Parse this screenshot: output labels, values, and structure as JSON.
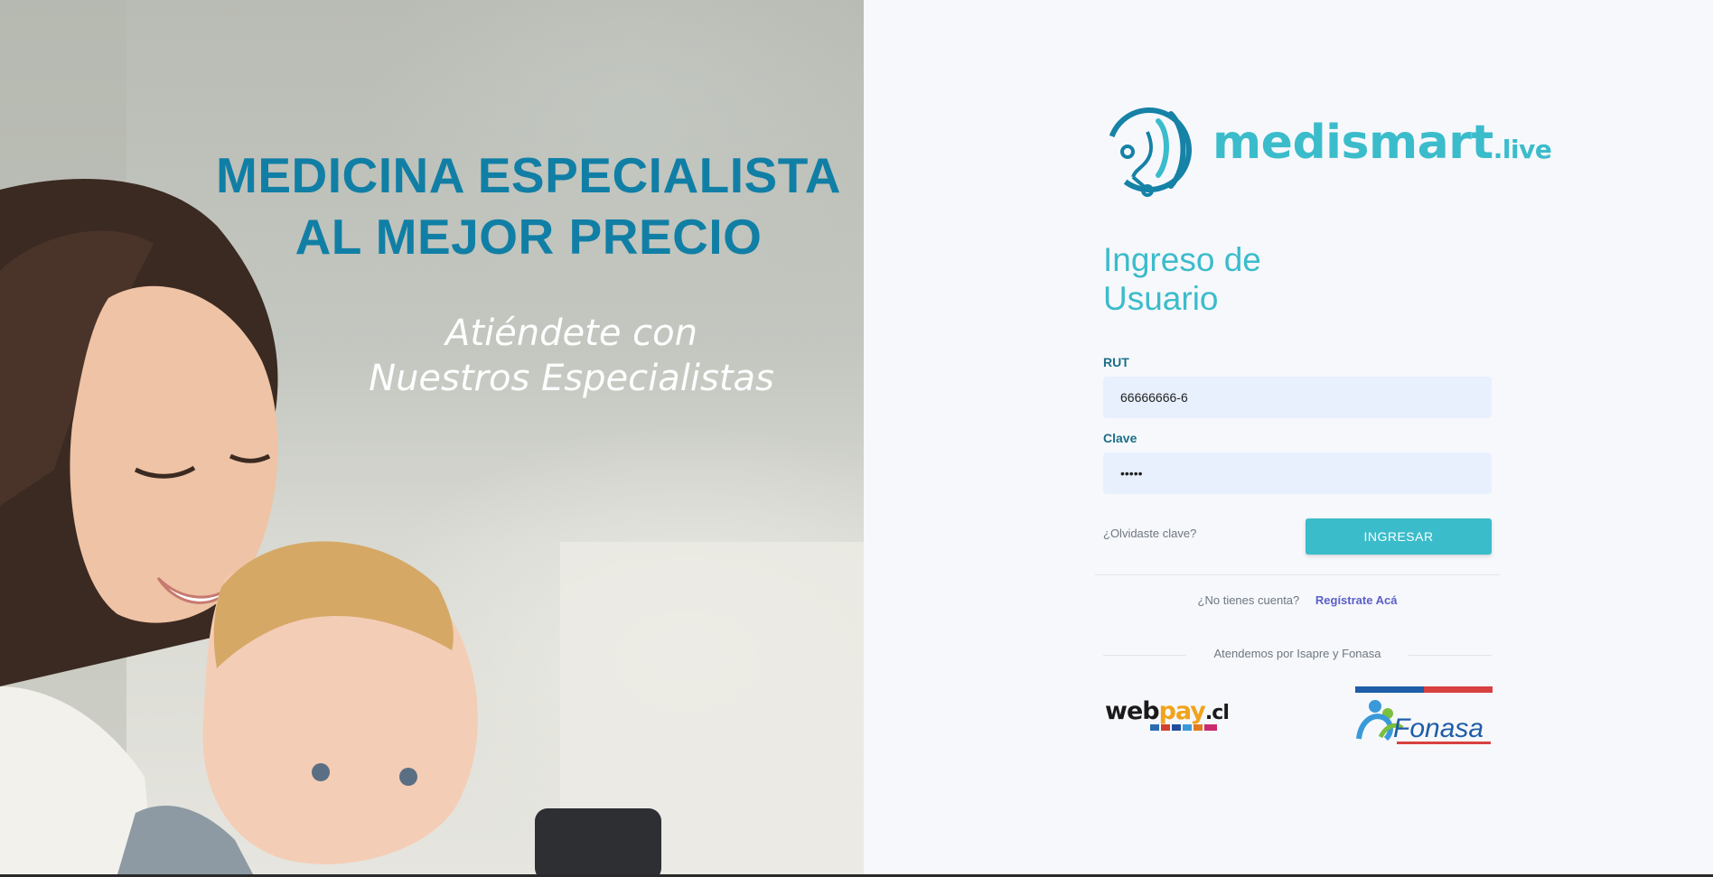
{
  "hero": {
    "heading_line1": "MEDICINA ESPECIALISTA",
    "heading_line2": "AL MEJOR PRECIO",
    "sub_line1": "Atiéndete con",
    "sub_line2": "Nuestros Especialistas"
  },
  "brand": {
    "name_main": "medismart",
    "name_suffix": ".live",
    "color": "#3bbccb",
    "dark": "#1582a6"
  },
  "login": {
    "title_line1": "Ingreso de",
    "title_line2": "Usuario",
    "rut_label": "RUT",
    "rut_value": "66666666-6",
    "clave_label": "Clave",
    "clave_value": "•••••",
    "forgot_label": "¿Olvidaste clave?",
    "submit_label": "INGRESAR"
  },
  "register": {
    "question": "¿No tienes cuenta?",
    "link_label": "Regístrate Acá"
  },
  "insurers": {
    "caption": "Atendemos por Isapre y Fonasa",
    "webpay_main": "webpay",
    "webpay_suffix": ".cl",
    "fonasa_name": "Fonasa"
  }
}
